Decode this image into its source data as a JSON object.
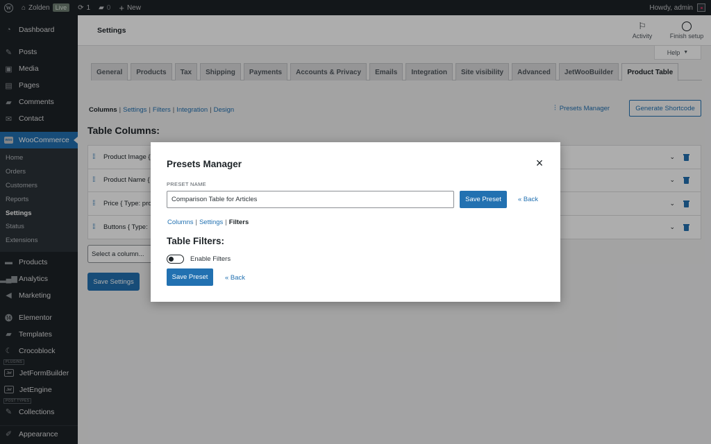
{
  "admin_bar": {
    "site_name": "Zolden",
    "live_badge": "Live",
    "updates_count": "1",
    "comments_count": "0",
    "new_label": "New",
    "greeting": "Howdy, admin"
  },
  "sidebar": {
    "items_top": [
      {
        "label": "Dashboard",
        "icon": "dashboard-icon"
      },
      {
        "label": "Posts",
        "icon": "pin-icon"
      },
      {
        "label": "Media",
        "icon": "media-icon"
      },
      {
        "label": "Pages",
        "icon": "pages-icon"
      },
      {
        "label": "Comments",
        "icon": "comment-icon"
      },
      {
        "label": "Contact",
        "icon": "envelope-icon"
      }
    ],
    "woocommerce": {
      "label": "WooCommerce",
      "icon_text": "woo"
    },
    "woo_submenu": [
      "Home",
      "Orders",
      "Customers",
      "Reports",
      "Settings",
      "Status",
      "Extensions"
    ],
    "woo_current": "Settings",
    "items_mid": [
      {
        "label": "Products",
        "icon": "archive-icon"
      },
      {
        "label": "Analytics",
        "icon": "bar-chart-icon"
      },
      {
        "label": "Marketing",
        "icon": "megaphone-icon"
      },
      {
        "label": "Elementor",
        "icon": "elementor-icon"
      },
      {
        "label": "Templates",
        "icon": "folder-icon"
      },
      {
        "label": "Crocoblock",
        "icon": "crocoblock-icon"
      }
    ],
    "separator_plugins": "PLUGINS",
    "jet_items": [
      {
        "label": "JetFormBuilder",
        "icon_text": "Jet"
      },
      {
        "label": "JetEngine",
        "icon_text": "Jet"
      }
    ],
    "separator_post_types": "POST TYPES",
    "items_bottom": [
      {
        "label": "Collections",
        "icon": "pin-icon"
      },
      {
        "label": "Appearance",
        "icon": "brush-icon"
      }
    ]
  },
  "header": {
    "title": "Settings",
    "activity_label": "Activity",
    "finish_setup_label": "Finish setup",
    "help_label": "Help"
  },
  "tabs": [
    {
      "label": "General",
      "active": false
    },
    {
      "label": "Products",
      "active": false
    },
    {
      "label": "Tax",
      "active": false
    },
    {
      "label": "Shipping",
      "active": false
    },
    {
      "label": "Payments",
      "active": false
    },
    {
      "label": "Accounts & Privacy",
      "active": false
    },
    {
      "label": "Emails",
      "active": false
    },
    {
      "label": "Integration",
      "active": false
    },
    {
      "label": "Site visibility",
      "active": false
    },
    {
      "label": "Advanced",
      "active": false
    },
    {
      "label": "JetWooBuilder",
      "active": false
    },
    {
      "label": "Product Table",
      "active": true
    }
  ],
  "subnav": {
    "current": "Columns",
    "links": [
      "Settings",
      "Filters",
      "Integration",
      "Design"
    ]
  },
  "presets_manager_link": "Presets Manager",
  "generate_shortcode_label": "Generate Shortcode",
  "table_columns_heading": "Table Columns:",
  "columns": [
    "Product Image {",
    "Product Name {",
    "Price { Type: pro",
    "Buttons { Type:"
  ],
  "select_column_placeholder": "Select a column...",
  "save_settings_label": "Save Settings",
  "modal": {
    "title": "Presets Manager",
    "preset_name_label": "PRESET NAME",
    "preset_name_value": "Comparison Table for Articles",
    "save_preset_label": "Save Preset",
    "back_label": "« Back",
    "subnav": {
      "links": [
        "Columns",
        "Settings"
      ],
      "current": "Filters"
    },
    "filters_heading": "Table Filters:",
    "enable_filters_label": "Enable Filters",
    "enable_filters_on": false
  },
  "colors": {
    "accent": "#2271b1",
    "admin_dark": "#1d2327",
    "overlay": "rgba(0,0,0,0.32)"
  }
}
